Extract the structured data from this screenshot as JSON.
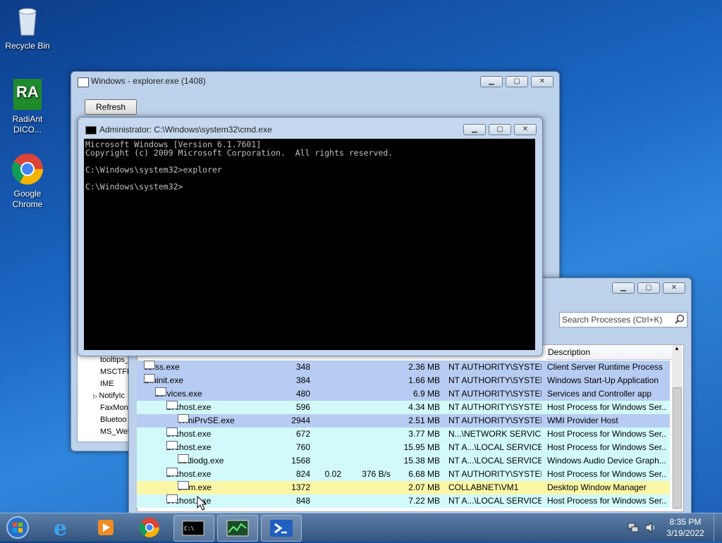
{
  "desktop": {
    "icons": [
      {
        "label": "Recycle Bin",
        "icon": "recycle-bin-icon"
      },
      {
        "label": "RadiAnt DICO...",
        "icon": "radiant-dicom-icon"
      },
      {
        "label": "Google Chrome",
        "icon": "chrome-icon"
      }
    ]
  },
  "explorer_window": {
    "title": "Windows - explorer.exe (1408)",
    "refresh_label": "Refresh",
    "list_items": [
      "tooltips_",
      "MSCTFIM",
      "IME",
      "NotifyIc",
      "FaxMon",
      "Bluetoo",
      "MS_Web"
    ]
  },
  "cmd_window": {
    "title": "Administrator: C:\\Windows\\system32\\cmd.exe",
    "lines": [
      "Microsoft Windows [Version 6.1.7601]",
      "Copyright (c) 2009 Microsoft Corporation.  All rights reserved.",
      "",
      "C:\\Windows\\system32>explorer",
      "",
      "C:\\Windows\\system32>"
    ]
  },
  "process_window": {
    "search_placeholder": "Search Processes (Ctrl+K)",
    "column_description": "Description",
    "rows": [
      {
        "name": "csrss.exe",
        "pid": "348",
        "cpu": "",
        "io": "",
        "mem": "2.36 MB",
        "user": "NT AUTHORITY\\SYSTEM",
        "desc": "Client Server Runtime Process",
        "color": "#b7ccf2",
        "indent": 0,
        "expander": false
      },
      {
        "name": "wininit.exe",
        "pid": "384",
        "cpu": "",
        "io": "",
        "mem": "1.66 MB",
        "user": "NT AUTHORITY\\SYSTEM",
        "desc": "Windows Start-Up Application",
        "color": "#b7ccf2",
        "indent": 0,
        "expander": true
      },
      {
        "name": "services.exe",
        "pid": "480",
        "cpu": "",
        "io": "",
        "mem": "6.9 MB",
        "user": "NT AUTHORITY\\SYSTEM",
        "desc": "Services and Controller app",
        "color": "#b7ccf2",
        "indent": 1,
        "expander": true
      },
      {
        "name": "svchost.exe",
        "pid": "596",
        "cpu": "",
        "io": "",
        "mem": "4.34 MB",
        "user": "NT AUTHORITY\\SYSTEM",
        "desc": "Host Process for Windows Ser...",
        "color": "#d2fafa",
        "indent": 2,
        "expander": true
      },
      {
        "name": "WmiPrvSE.exe",
        "pid": "2944",
        "cpu": "",
        "io": "",
        "mem": "2.51 MB",
        "user": "NT AUTHORITY\\SYSTEM",
        "desc": "WMI Provider Host",
        "color": "#b7ccf2",
        "indent": 3,
        "expander": false
      },
      {
        "name": "svchost.exe",
        "pid": "672",
        "cpu": "",
        "io": "",
        "mem": "3.77 MB",
        "user": "N...\\NETWORK SERVICE",
        "desc": "Host Process for Windows Ser...",
        "color": "#d2fafa",
        "indent": 2,
        "expander": false
      },
      {
        "name": "svchost.exe",
        "pid": "760",
        "cpu": "",
        "io": "",
        "mem": "15.95 MB",
        "user": "NT A...\\LOCAL SERVICE",
        "desc": "Host Process for Windows Ser...",
        "color": "#d2fafa",
        "indent": 2,
        "expander": true
      },
      {
        "name": "audiodg.exe",
        "pid": "1568",
        "cpu": "",
        "io": "",
        "mem": "15.38 MB",
        "user": "NT A...\\LOCAL SERVICE",
        "desc": "Windows Audio Device Graph...",
        "color": "#d2fafa",
        "indent": 3,
        "expander": false
      },
      {
        "name": "svchost.exe",
        "pid": "824",
        "cpu": "0.02",
        "io": "376 B/s",
        "mem": "6.68 MB",
        "user": "NT AUTHORITY\\SYSTEM",
        "desc": "Host Process for Windows Ser...",
        "color": "#d2fafa",
        "indent": 2,
        "expander": true
      },
      {
        "name": "dwm.exe",
        "pid": "1372",
        "cpu": "",
        "io": "",
        "mem": "2.07 MB",
        "user": "COLLABNET\\VM1",
        "desc": "Desktop Window Manager",
        "color": "#fbf7a6",
        "indent": 3,
        "expander": false
      },
      {
        "name": "svchost.exe",
        "pid": "848",
        "cpu": "",
        "io": "",
        "mem": "7.22 MB",
        "user": "NT A...\\LOCAL SERVICE",
        "desc": "Host Process for Windows Ser...",
        "color": "#d2fafa",
        "indent": 2,
        "expander": false
      }
    ]
  },
  "taskbar": {
    "apps": [
      "start-orb-icon",
      "internet-explorer-icon",
      "media-player-icon",
      "chrome-icon",
      "cmd-icon",
      "process-hacker-icon",
      "powershell-icon"
    ],
    "time": "8:35 PM",
    "date": "3/19/2022"
  }
}
